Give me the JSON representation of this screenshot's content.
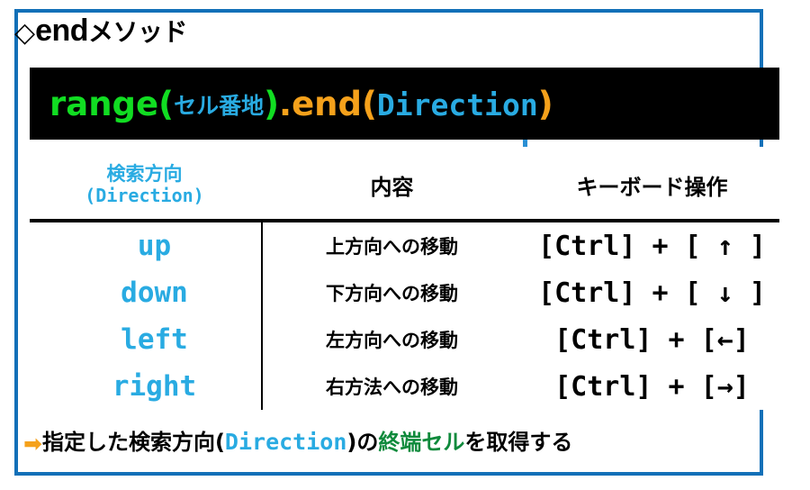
{
  "frame": {
    "border_color": "#1270b8"
  },
  "title": {
    "bullet": "◇",
    "latin": "end",
    "kana": "メソッド"
  },
  "code_block": {
    "background": "#000000",
    "segments": {
      "fn_name": "range",
      "paren_open": "(",
      "arg_jp": "セル番地",
      "paren_close": ")",
      "dot": ".",
      "method": "end",
      "method_paren_open": "(",
      "method_arg": "Direction",
      "method_paren_close": ")"
    },
    "colors": {
      "green": "#11dd22",
      "cyan": "#29abe2",
      "orange": "#f5a11b"
    }
  },
  "table": {
    "headers": {
      "direction_line1": "検索方向",
      "direction_line2": "(Direction)",
      "content": "内容",
      "keyboard": "キーボード操作"
    },
    "rows": [
      {
        "direction": "up",
        "description": "上方向への移動",
        "keyboard": "[Ctrl] + [ ↑ ]"
      },
      {
        "direction": "down",
        "description": "下方向への移動",
        "keyboard": "[Ctrl] + [ ↓ ]"
      },
      {
        "direction": "left",
        "description": "左方向への移動",
        "keyboard": "[Ctrl] + [←]"
      },
      {
        "direction": "right",
        "description": "右方法への移動",
        "keyboard": "[Ctrl] + [→]"
      }
    ]
  },
  "caption": {
    "arrow": "➡",
    "part1": "指定した検索方向(",
    "highlight_cyan": "Direction",
    "part2": ")の",
    "highlight_green": "終端セル",
    "part3": "を取得する"
  }
}
